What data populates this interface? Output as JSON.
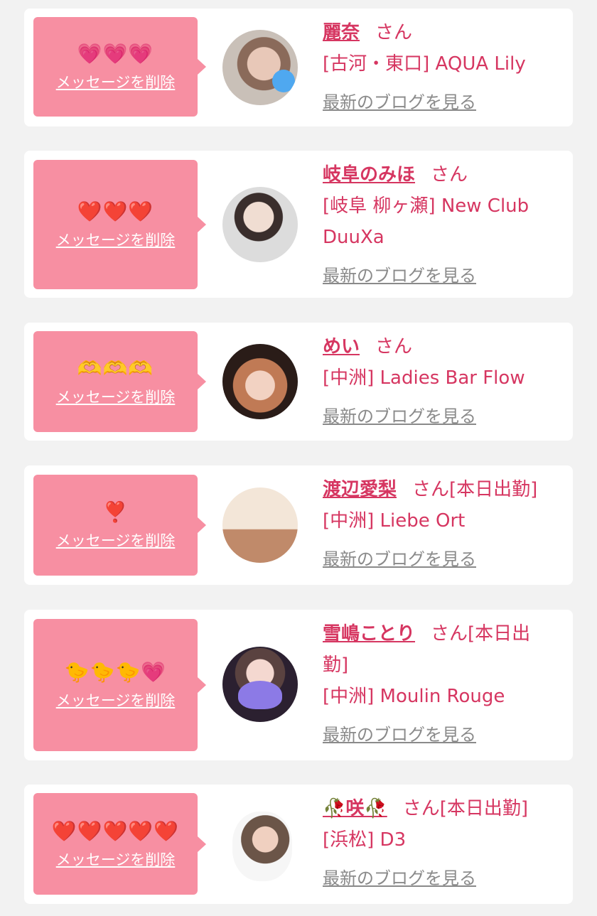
{
  "common": {
    "delete_label": "メッセージを削除",
    "blog_label": "最新のブログを見る",
    "accent": "#d63661",
    "bubble_color": "#f78fa2"
  },
  "cards": [
    {
      "emoji": "💗💗💗",
      "name": "麗奈",
      "san": "さん",
      "shop_lines": [
        "[古河・東口] AQUA Lily"
      ]
    },
    {
      "emoji": "❤️❤️❤️",
      "name": "岐阜のみほ",
      "san": "さん",
      "shop_lines": [
        "[岐阜 柳ヶ瀬] New Club",
        "DuuXa"
      ]
    },
    {
      "emoji": "🫶🫶🫶",
      "name": "めい",
      "san": "さん",
      "shop_lines": [
        "[中洲] Ladies Bar Flow"
      ]
    },
    {
      "emoji": "❣️",
      "name": "渡辺愛梨",
      "san": "さん[本日出勤]",
      "shop_lines": [
        "[中洲] Liebe Ort"
      ]
    },
    {
      "emoji": "🐤🐤🐤💗",
      "name": "雪嶋ことり",
      "san": "さん[本日出",
      "san_cont": "勤]",
      "shop_lines": [
        "[中洲] Moulin Rouge"
      ]
    },
    {
      "emoji": "❤️❤️❤️❤️❤️",
      "name": "🥀咲🥀",
      "san": "さん[本日出勤]",
      "shop_lines": [
        "[浜松] D3"
      ]
    }
  ]
}
